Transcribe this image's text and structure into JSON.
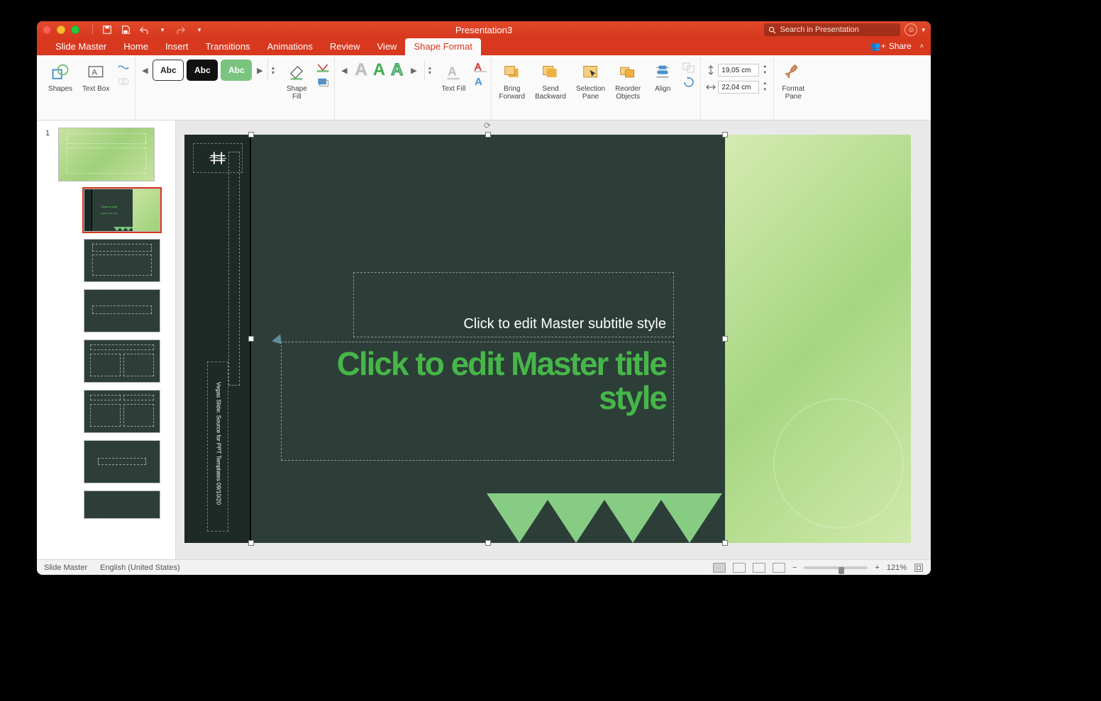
{
  "window": {
    "title": "Presentation3",
    "search_placeholder": "Search in Presentation",
    "share_label": "Share"
  },
  "tabs": {
    "items": [
      "Slide Master",
      "Home",
      "Insert",
      "Transitions",
      "Animations",
      "Review",
      "View",
      "Shape Format"
    ],
    "active": "Shape Format"
  },
  "ribbon": {
    "shapes_label": "Shapes",
    "textbox_label": "Text Box",
    "style_sample": "Abc",
    "shape_fill_label": "Shape Fill",
    "text_fill_label": "Text Fill",
    "bring_forward_label": "Bring Forward",
    "send_backward_label": "Send Backward",
    "selection_pane_label": "Selection Pane",
    "reorder_objects_label": "Reorder Objects",
    "align_label": "Align",
    "size_height": "19,05 cm",
    "size_width": "22,04 cm",
    "format_pane_label": "Format Pane"
  },
  "thumbnails": {
    "master_index": "1",
    "layout_count": 7
  },
  "slide": {
    "subtitle_placeholder": "Click to edit Master subtitle style",
    "title_placeholder": "Click to edit Master title style",
    "footer_text": "Vegas Slide: Source for PPT Templates  09/10/20"
  },
  "status": {
    "view_label": "Slide Master",
    "language": "English (United States)",
    "zoom": "121%"
  }
}
